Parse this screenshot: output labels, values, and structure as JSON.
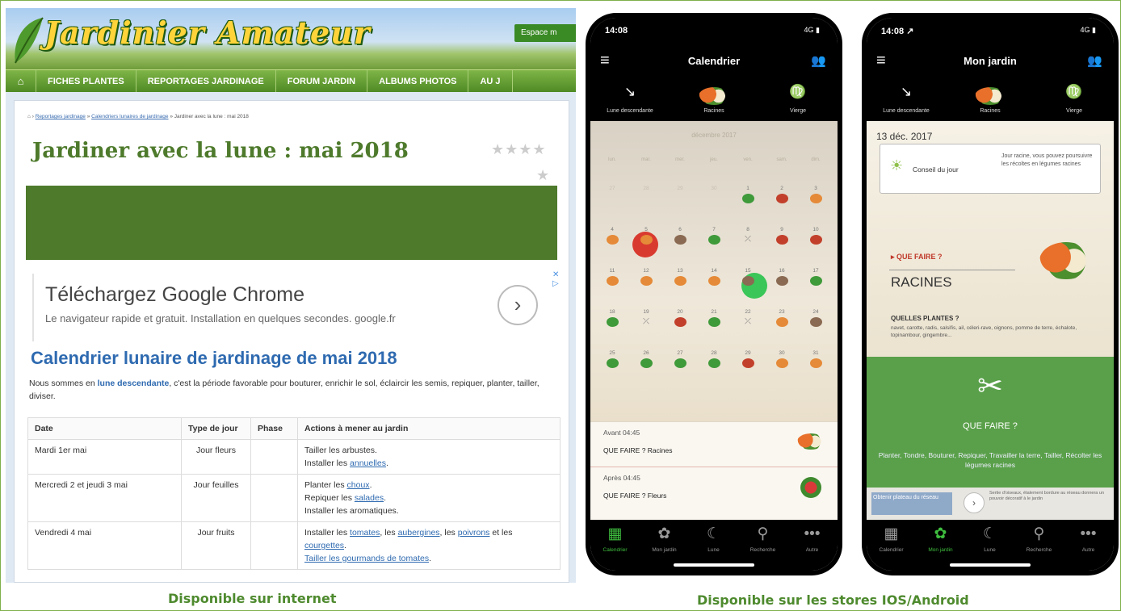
{
  "site": {
    "logo_text": "Jardinier Amateur",
    "espace": "Espace m",
    "nav": [
      "FICHES PLANTES",
      "REPORTAGES JARDINAGE",
      "FORUM JARDIN",
      "ALBUMS PHOTOS",
      "AU J"
    ],
    "breadcrumb": {
      "home": "›",
      "c1": "Reportages jardinage",
      "c2": "Calendriers lunaires de jardinage",
      "current": "» Jardiner avec la lune : mai 2018"
    },
    "page_title": "Jardiner avec la lune : mai 2018",
    "stars": "★★★★",
    "star5": "★",
    "ad": {
      "title": "Téléchargez Google Chrome",
      "desc": "Le navigateur rapide et gratuit. Installation en quelques secondes.",
      "domain": "google.fr",
      "close": "✕",
      "info": "▷"
    },
    "section_title": "Calendrier lunaire de jardinage de mai 2018",
    "intro_a": "Nous sommes en ",
    "intro_b": "lune descendante",
    "intro_c": ", c'est la période favorable pour bouturer, enrichir le sol, éclaircir les semis, repiquer, planter, tailler, diviser.",
    "table": {
      "headers": [
        "Date",
        "Type de jour",
        "Phase",
        "Actions à mener au jardin"
      ],
      "rows": [
        {
          "date": "Mardi 1er mai",
          "type": "Jour fleurs",
          "phase": "",
          "a1": "Tailler les arbustes.",
          "a2pre": "Installer les ",
          "a2link": "annuelles",
          "a2post": "."
        },
        {
          "date": "Mercredi 2 et jeudi 3 mai",
          "type": "Jour feuilles",
          "phase": "",
          "a1pre": "Planter les ",
          "a1link": "choux",
          "a1post": ".",
          "a2pre": "Repiquer les ",
          "a2link": "salades",
          "a2post": ".",
          "a3": "Installer les aromatiques."
        },
        {
          "date": "Vendredi 4 mai",
          "type": "Jour fruits",
          "phase": "",
          "a1pre": "Installer les ",
          "l1": "tomates",
          "s1": ", les ",
          "l2": "aubergines",
          "s2": ", les ",
          "l3": "poivrons",
          "s3": " et les ",
          "l4": "courgettes",
          "s4": ".",
          "a2link": "Tailler les gourmands de tomates",
          "a2post": "."
        }
      ]
    }
  },
  "phone1": {
    "time": "14:08",
    "signal": "4G ▮",
    "title": "Calendrier",
    "moon": [
      "Lune descendante",
      "Racines",
      "Vierge"
    ],
    "month": "décembre 2017",
    "weekdays": [
      "lun.",
      "mar.",
      "mer.",
      "jeu.",
      "ven.",
      "sam.",
      "dim."
    ],
    "rows": [
      {
        "time": "Avant 04:45",
        "what": "QUE FAIRE ? Racines"
      },
      {
        "time": "Après 04:45",
        "what": "QUE FAIRE ? Fleurs"
      }
    ],
    "tabs": [
      "Calendrier",
      "Mon jardin",
      "Lune",
      "Recherche",
      "Autre"
    ]
  },
  "phone2": {
    "time": "14:08 ↗",
    "signal": "4G ▮",
    "title": "Mon jardin",
    "moon": [
      "Lune descendante",
      "Racines",
      "Vierge"
    ],
    "date": "13 déc. 2017",
    "conseil_label": "Conseil du jour",
    "conseil_text": "Jour racine, vous pouvez poursuivre les récoltes en légumes racines",
    "qf_small": "▸ QUE FAIRE ?",
    "racines": "RACINES",
    "qp": "QUELLES PLANTES ?",
    "qp_text": "navet, carotte, radis, salsifis, ail, céleri-rave, oignons, pomme de terre, échalote, topinambour, gingembre...",
    "gp_title": "QUE FAIRE ?",
    "gp_text": "Planter, Tondre, Bouturer, Repiquer, Travailler la terre, Tailler, Récolter les légumes racines",
    "ad_a": "Obtenir plateau du réseau",
    "ad_btn": "›",
    "ad_b": "Sertie d'oiseaux, étalement bordure au réseau donnera un pouvoir décoratif à le jardin",
    "tabs": [
      "Calendrier",
      "Mon jardin",
      "Lune",
      "Recherche",
      "Autre"
    ]
  },
  "captions": {
    "web": "Disponible sur internet",
    "app": "Disponible sur les stores IOS/Android"
  }
}
